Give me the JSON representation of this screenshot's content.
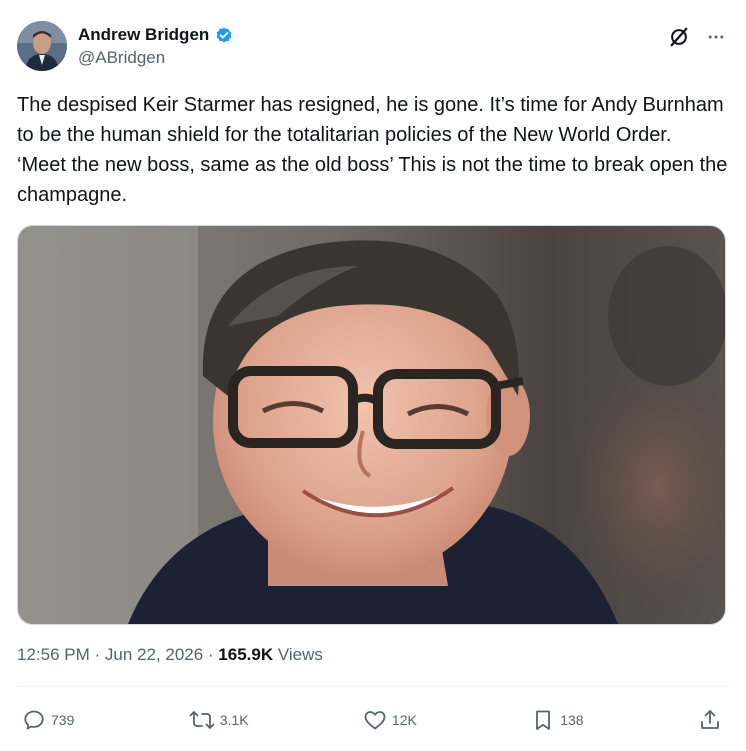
{
  "author": {
    "name": "Andrew Bridgen",
    "handle": "@ABridgen",
    "verified_color": "#1d9bf0"
  },
  "top_icons": [
    "grok-icon",
    "more-icon"
  ],
  "tweet": {
    "text": "The despised Keir Starmer has resigned, he is gone. It’s time for Andy Burnham to be the human shield for the totalitarian policies of the New World Order.  ‘Meet the new boss, same as the old boss’ This is not the time to break open the champagne."
  },
  "meta": {
    "time": "12:56 PM",
    "sep1": " · ",
    "date": "Jun 22, 2026",
    "sep2": " · ",
    "views_count": "165.9K",
    "views_label": " Views"
  },
  "actions": {
    "replies": "739",
    "reposts": "3.1K",
    "likes": "12K",
    "bookmarks": "138"
  },
  "colors": {
    "text": "#0f1419",
    "secondary": "#536471",
    "border": "#cfd9de"
  }
}
